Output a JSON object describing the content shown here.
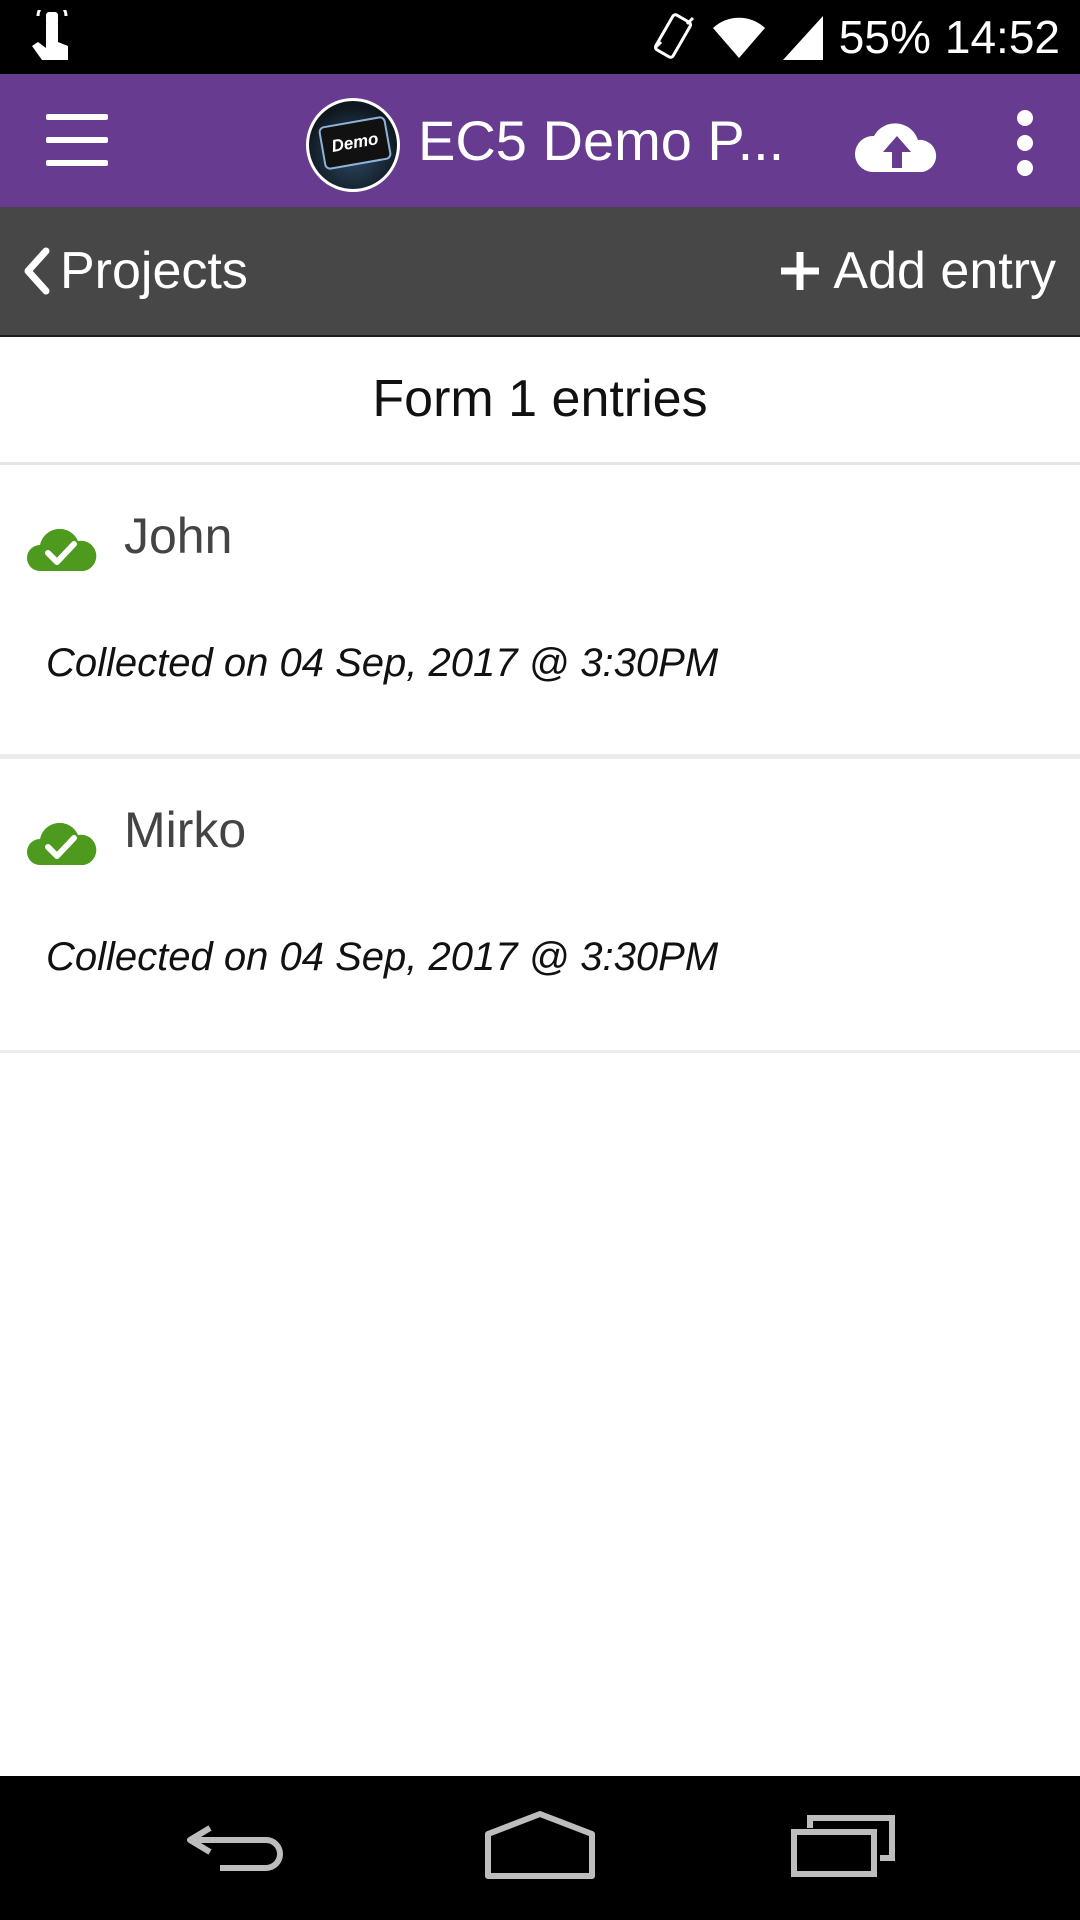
{
  "status_bar": {
    "battery": "55%",
    "time": "14:52",
    "icons": [
      "touch-icon",
      "vibrate-icon",
      "wifi-icon",
      "signal-icon"
    ]
  },
  "app_bar": {
    "title": "EC5 Demo P...",
    "logo_text": "Demo",
    "color": "#673c90",
    "icons": [
      "menu-icon",
      "upload-cloud-icon",
      "overflow-menu-icon"
    ]
  },
  "nav": {
    "back_label": "Projects",
    "add_label": "Add entry",
    "color": "#474747"
  },
  "form": {
    "title": "Form 1 entries"
  },
  "entries": [
    {
      "title": "John",
      "subtitle": "Collected on 04 Sep, 2017 @ 3:30PM",
      "status_icon": "cloud-check-icon"
    },
    {
      "title": "Mirko",
      "subtitle": "Collected on 04 Sep, 2017 @ 3:30PM",
      "status_icon": "cloud-check-icon"
    }
  ],
  "colors": {
    "sync_ok": "#4e9a1f"
  },
  "system_nav": {
    "icons": [
      "back-icon",
      "home-icon",
      "recents-icon"
    ]
  }
}
